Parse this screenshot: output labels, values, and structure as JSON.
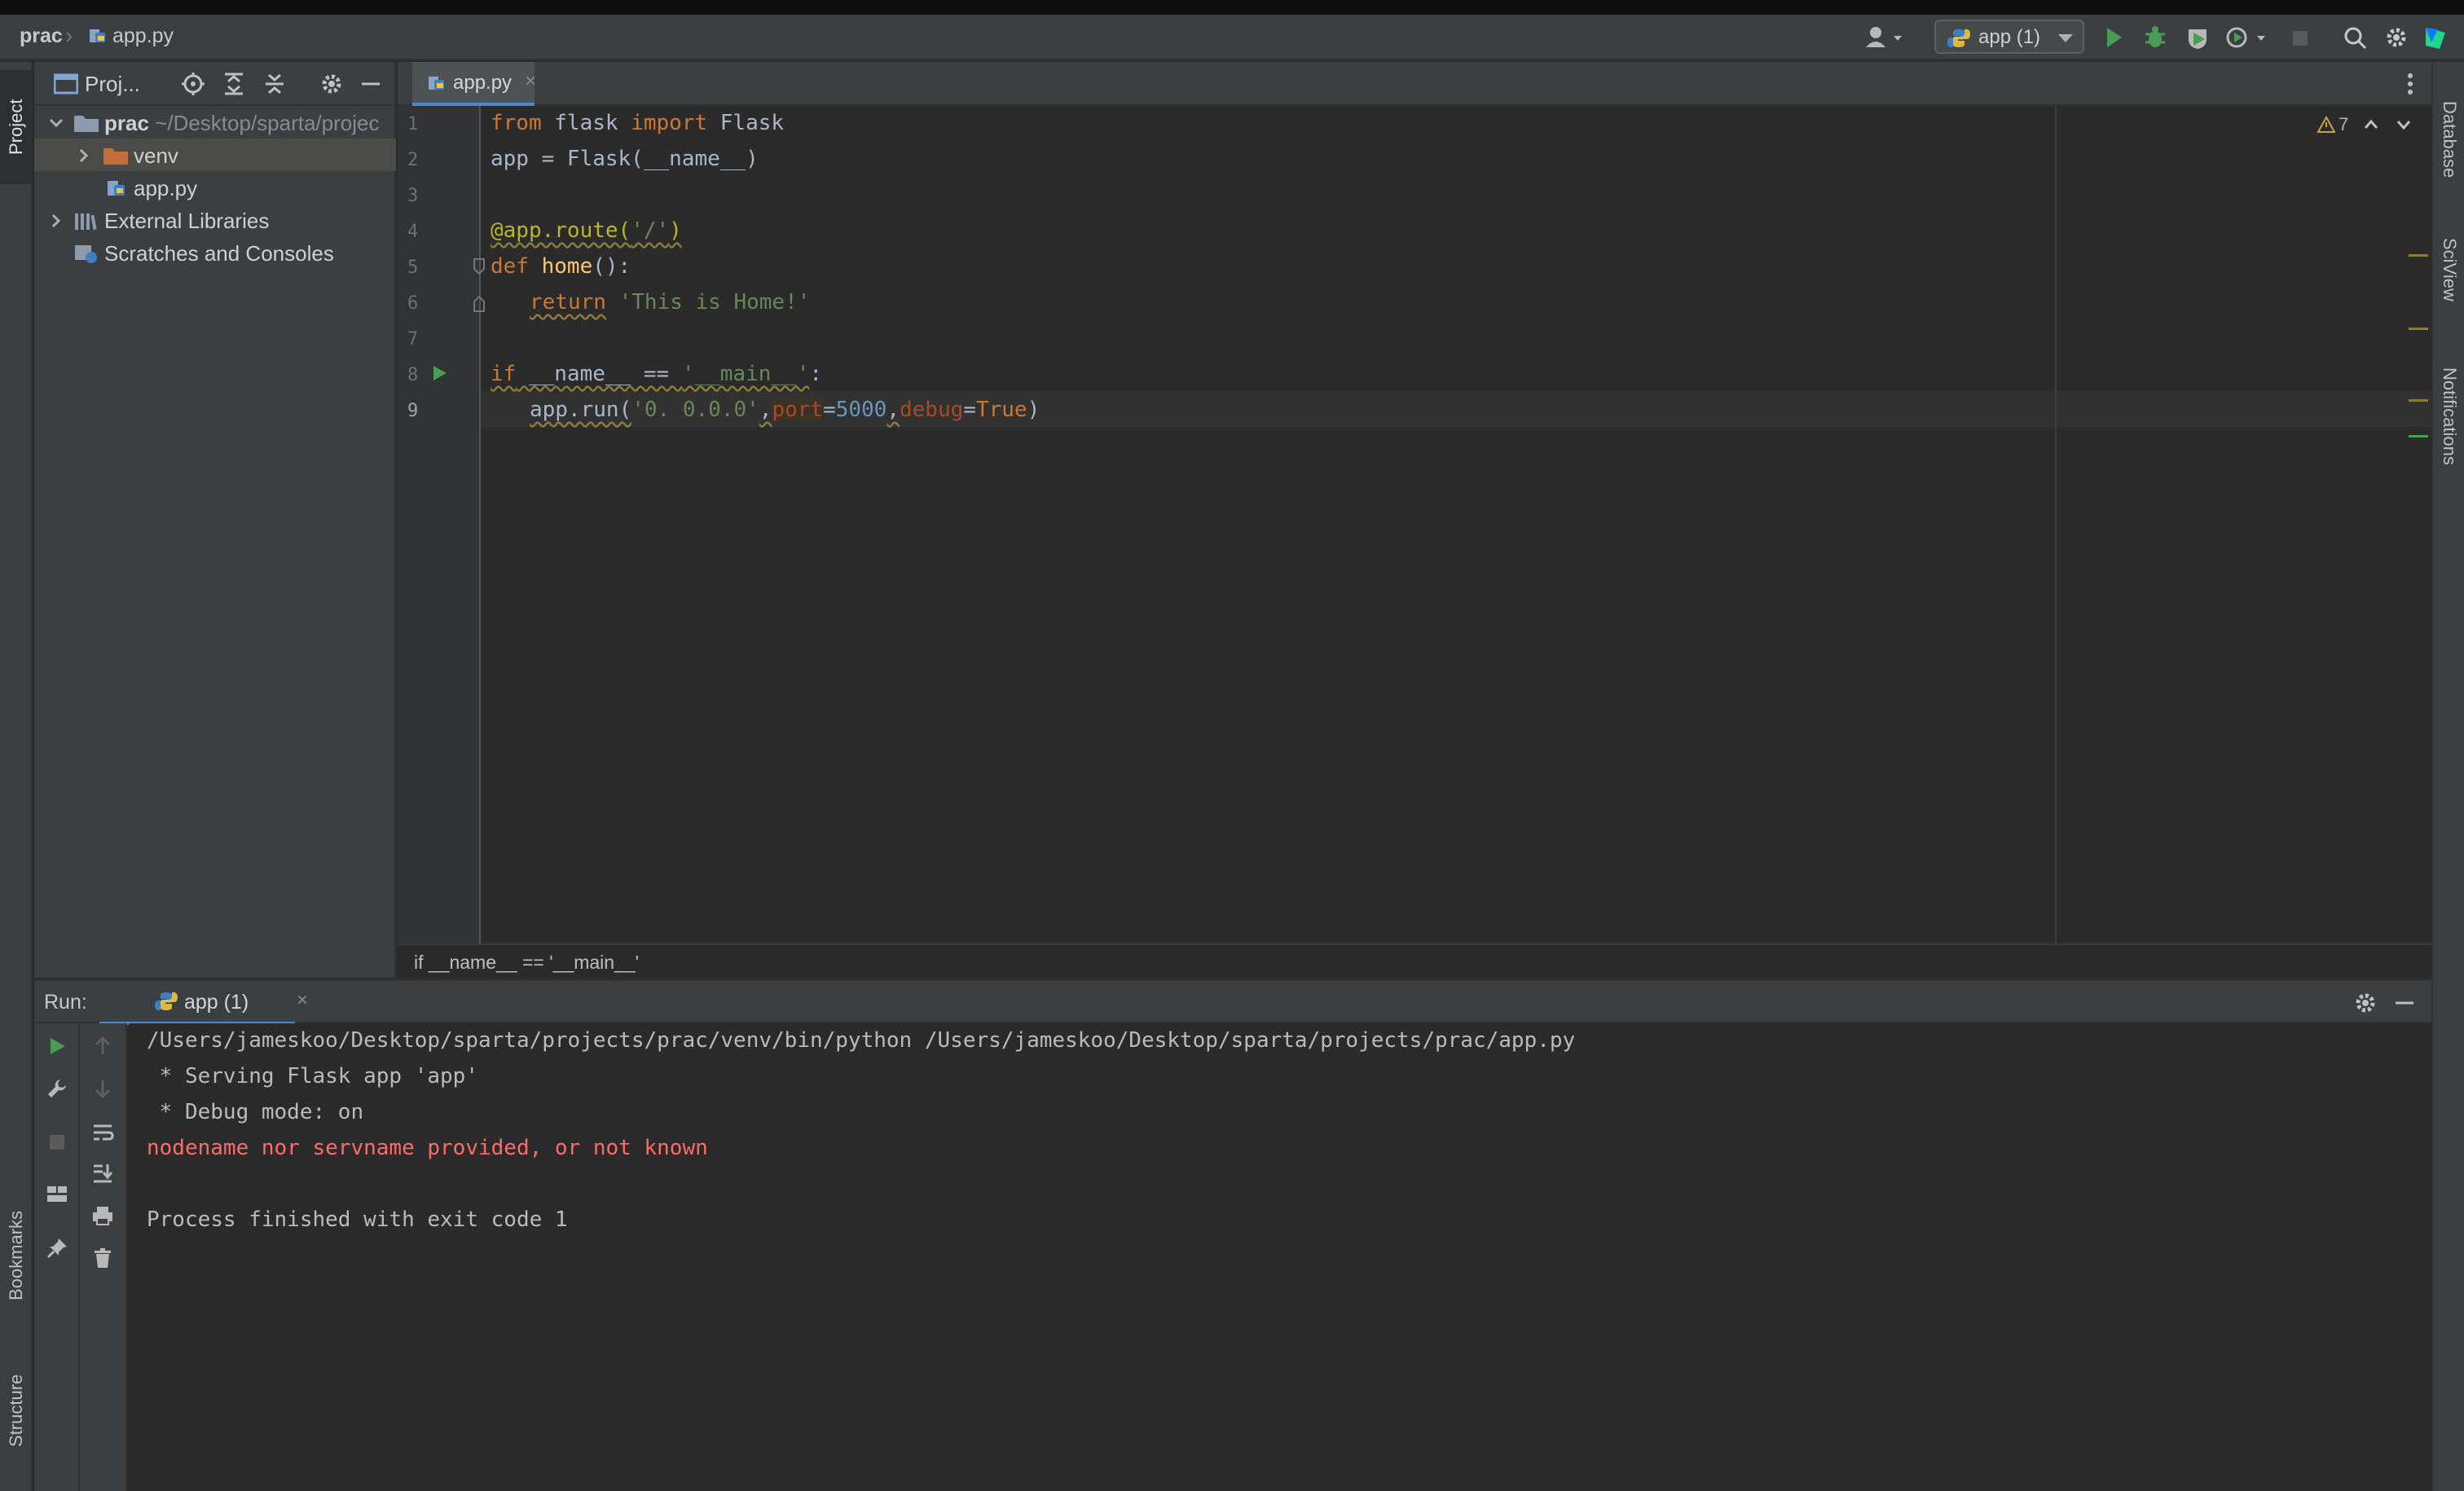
{
  "breadcrumb": {
    "project": "prac",
    "file": "app.py"
  },
  "toolbar": {
    "run_config": "app (1)"
  },
  "left_stripe": {
    "project_tab": "Project",
    "bookmarks_tab": "Bookmarks",
    "structure_tab": "Structure"
  },
  "right_stripe": {
    "database_tab": "Database",
    "sciview_tab": "SciView",
    "notifications_tab": "Notifications"
  },
  "project_panel": {
    "title": "Proj...",
    "tree": [
      {
        "label": "prac",
        "sub": "~/Desktop/sparta/projec"
      },
      {
        "label": "venv"
      },
      {
        "label": "app.py"
      },
      {
        "label": "External Libraries"
      },
      {
        "label": "Scratches and Consoles"
      }
    ]
  },
  "editor": {
    "tab_label": "app.py",
    "warning_count": "7",
    "line_numbers": [
      "1",
      "2",
      "3",
      "4",
      "5",
      "6",
      "7",
      "8",
      "9"
    ],
    "code": {
      "l1": {
        "kw1": "from",
        "mod": " flask ",
        "kw2": "import",
        "cls": " Flask"
      },
      "l2": "app = Flask(__name__)",
      "l4": {
        "deco": "@app.route(",
        "str": "'/'",
        "close": ")"
      },
      "l5": {
        "kw": "def",
        "fn": "home",
        "rest": "():"
      },
      "l6": {
        "kw": "return",
        "str": "'This is Home!'"
      },
      "l8": {
        "kw": "if",
        "name": " __name__ == ",
        "str": "'__main__'",
        "rest": ":"
      },
      "l9": {
        "pre": "app.run(",
        "str": "'0. 0.0.0'",
        "c1": ",",
        "p1": "port",
        "eq1": "=",
        "n1": "5000",
        "c2": ",",
        "p2": "debug",
        "eq2": "=",
        "v2": "True",
        "close": ")"
      }
    },
    "breadcrumb": "if __name__ == '__main__'"
  },
  "run_panel": {
    "title": "Run:",
    "tab_label": "app (1)",
    "output": [
      {
        "text": "/Users/jameskoo/Desktop/sparta/projects/prac/venv/bin/python /Users/jameskoo/Desktop/sparta/projects/prac/app.py",
        "type": "normal"
      },
      {
        "text": " * Serving Flask app 'app'",
        "type": "normal"
      },
      {
        "text": " * Debug mode: on",
        "type": "normal"
      },
      {
        "text": "nodename nor servname provided, or not known",
        "type": "error"
      },
      {
        "text": "",
        "type": "normal"
      },
      {
        "text": "Process finished with exit code 1",
        "type": "normal"
      }
    ]
  },
  "colors": {
    "keyword": "#cc7832",
    "function": "#ffc66d",
    "string": "#6a8759",
    "number": "#6897bb",
    "decorator": "#bbb529",
    "error": "#ff6b68",
    "run_green": "#499c54",
    "accent_blue": "#4a88c7"
  }
}
